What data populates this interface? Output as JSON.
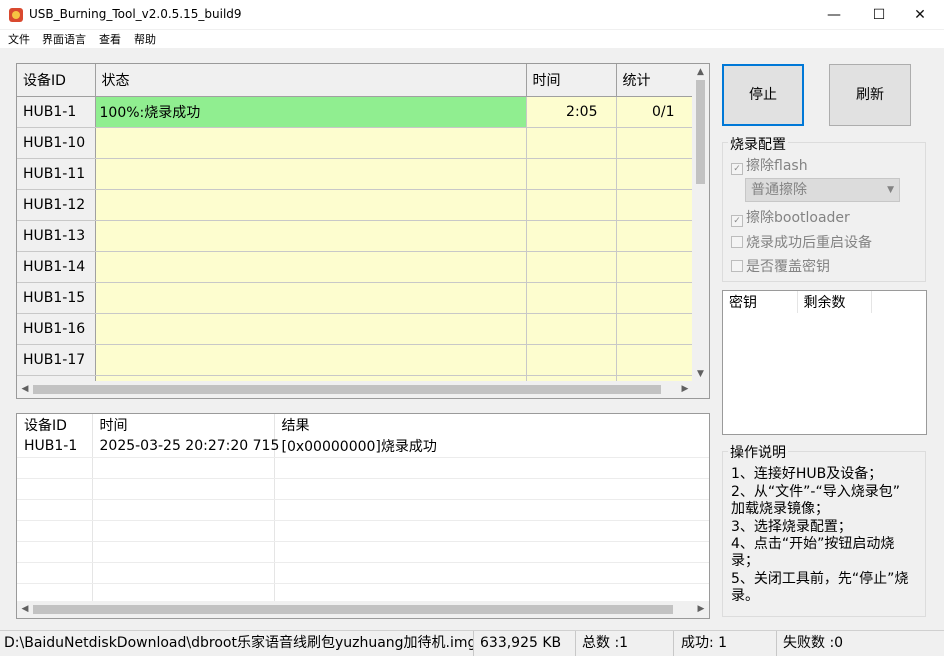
{
  "window": {
    "title": "USB_Burning_Tool_v2.0.5.15_build9",
    "min": "—",
    "max": "☐",
    "close": "✕"
  },
  "menu": [
    "文件",
    "界面语言",
    "查看",
    "帮助"
  ],
  "grid": {
    "headers": [
      "设备ID",
      "状态",
      "时间",
      "统计"
    ],
    "rows": [
      {
        "id": "HUB1-1",
        "status": "100%:烧录成功",
        "time": "2:05",
        "count": "0/1",
        "state": "success"
      },
      {
        "id": "HUB1-10",
        "status": "",
        "time": "",
        "count": ""
      },
      {
        "id": "HUB1-11",
        "status": "",
        "time": "",
        "count": ""
      },
      {
        "id": "HUB1-12",
        "status": "",
        "time": "",
        "count": ""
      },
      {
        "id": "HUB1-13",
        "status": "",
        "time": "",
        "count": ""
      },
      {
        "id": "HUB1-14",
        "status": "",
        "time": "",
        "count": ""
      },
      {
        "id": "HUB1-15",
        "status": "",
        "time": "",
        "count": ""
      },
      {
        "id": "HUB1-16",
        "status": "",
        "time": "",
        "count": ""
      },
      {
        "id": "HUB1-17",
        "status": "",
        "time": "",
        "count": ""
      },
      {
        "id": "",
        "status": "",
        "time": "",
        "count": ""
      }
    ]
  },
  "log": {
    "headers": [
      "设备ID",
      "时间",
      "结果"
    ],
    "rows": [
      {
        "id": "HUB1-1",
        "time": "2025-03-25 20:27:20 715",
        "result": "[0x00000000]烧录成功"
      }
    ]
  },
  "buttons": {
    "stop": "停止",
    "refresh": "刷新"
  },
  "burn_config": {
    "title": "烧录配置",
    "erase_flash": "擦除flash",
    "erase_mode": "普通擦除",
    "erase_bootloader": "擦除bootloader",
    "reboot_after": "烧录成功后重启设备",
    "overwrite_key": "是否覆盖密钥"
  },
  "key_list": {
    "headers": [
      "密钥",
      "剩余数"
    ]
  },
  "help": {
    "title": "操作说明",
    "lines": [
      "1、连接好HUB及设备；",
      "2、从“文件”-“导入烧录包”",
      "加载烧录镜像；",
      "3、选择烧录配置；",
      "4、点击“开始”按钮启动烧",
      "录；",
      "5、关闭工具前，先“停止”烧",
      "录。"
    ]
  },
  "status_bar": {
    "path": "D:\\BaiduNetdiskDownload\\dbroot乐家语音线刷包yuzhuang加待机.img",
    "size": "633,925 KB",
    "total": "总数 :1",
    "success": "成功:  1",
    "failed": "失败数 :0"
  },
  "colors": {
    "success_row": "#90ee90",
    "empty_cell": "#fdfdcf",
    "accent": "#0078d7"
  }
}
